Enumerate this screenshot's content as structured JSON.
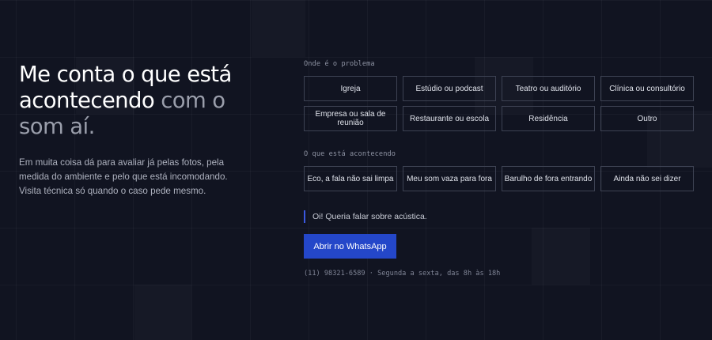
{
  "hero": {
    "headline_line1": "Me conta o que está",
    "headline_line2_strong": "acontecendo",
    "headline_line2_muted": " com o",
    "headline_line3_muted": "som aí.",
    "description": "Em muita coisa dá para avaliar já pelas fotos, pela medida do ambiente e pelo que está incomodando. Visita técnica só quando o caso pede mesmo."
  },
  "form": {
    "location_label": "Onde é o problema",
    "locations": [
      "Igreja",
      "Estúdio ou podcast",
      "Teatro ou auditório",
      "Clínica ou consultório",
      "Empresa ou sala de reunião",
      "Restaurante ou escola",
      "Residência",
      "Outro"
    ],
    "issue_label": "O que está acontecendo",
    "issues": [
      "Eco, a fala não sai limpa",
      "Meu som vaza para fora",
      "Barulho de fora entrando",
      "Ainda não sei dizer"
    ],
    "message_preview": "Oi! Queria falar sobre acústica.",
    "cta_label": "Abrir no WhatsApp",
    "contact_info": "(11) 98321-6589 · Segunda a sexta, das 8h às 18h"
  },
  "colors": {
    "background": "#111421",
    "accent": "#2447c9",
    "chip_border": "#3d4253"
  }
}
